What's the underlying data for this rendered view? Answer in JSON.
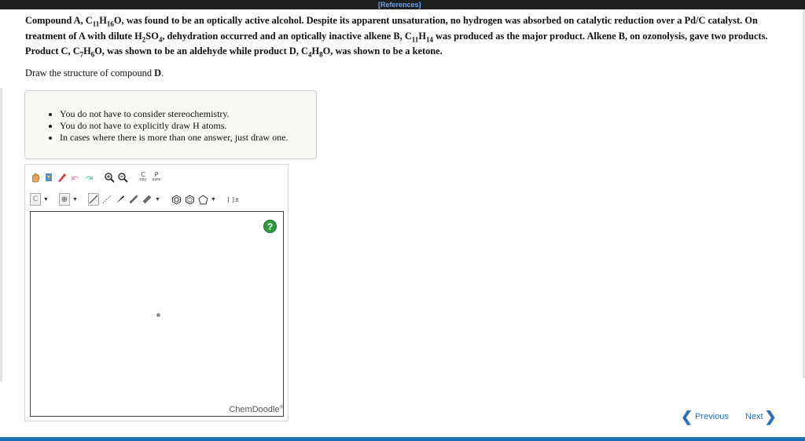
{
  "header": {
    "references_label": "[References]"
  },
  "question": {
    "t1": "Compound A, C",
    "s1": "11",
    "t2": "H",
    "s2": "16",
    "t3": "O, was found to be an optically active alcohol. Despite its apparent unsaturation, no hydrogen was absorbed on catalytic reduction over a Pd/C catalyst. On treatment of A with dilute H",
    "s3": "2",
    "t4": "SO",
    "s4": "4",
    "t5": ", dehydration occurred and an optically inactive alkene B, C",
    "s5": "11",
    "t6": "H",
    "s6": "14",
    "t7": " was produced as the major product. Alkene B, on ozonolysis, gave two products. Product C, C",
    "s7": "7",
    "t8": "H",
    "s8": "6",
    "t9": "O, was shown to be an aldehyde while product D, C",
    "s9": "4",
    "t10": "H",
    "s10": "8",
    "t11": "O, was shown to be a ketone."
  },
  "prompt": {
    "text": "Draw the structure of compound ",
    "target": "D",
    "end": "."
  },
  "notes": [
    "You do not have to consider stereochemistry.",
    "You do not have to explicitly draw H atoms.",
    "In cases where there is more than one answer, just draw one."
  ],
  "toolbar": {
    "row1": {
      "copy_label_top": "C",
      "copy_label_bottom": "opy",
      "paste_label_top": "P",
      "paste_label_bottom": "aste"
    },
    "row2": {
      "element_selected": "C",
      "charge_symbol": "⊕",
      "bracket_label": "[ ]±"
    }
  },
  "sketcher": {
    "help_label": "?",
    "brand": "ChemDoodle",
    "brand_mark": "®"
  },
  "navigation": {
    "previous": "Previous",
    "next": "Next"
  },
  "colors": {
    "accent": "#2a6fbd",
    "help_green": "#2e9b3c",
    "top_bar": "#1f1f1f",
    "reference_link": "#6aa6e8"
  }
}
